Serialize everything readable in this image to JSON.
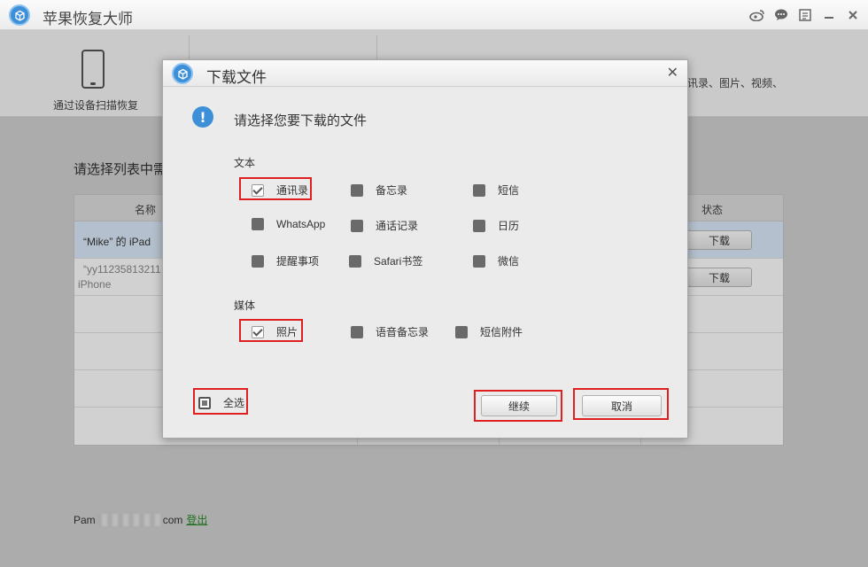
{
  "app": {
    "title": "苹果恢复大师",
    "titlebar_icons": [
      "weibo-icon",
      "chat-icon",
      "feedback-icon",
      "minimize-icon",
      "close-icon"
    ]
  },
  "toolbar": {
    "tool1_label": "通过设备扫描恢复",
    "tool_desc": "讯录、图片、视频、"
  },
  "main": {
    "heading": "请选择列表中需",
    "table": {
      "header_name": "名称",
      "header_status": "状态",
      "rows": [
        {
          "name": "“Mike” 的 iPad",
          "button": "下载",
          "selected": true
        },
        {
          "name_line1": "“yy11235813211",
          "name_line2": "iPhone",
          "button": "下载",
          "selected": false
        }
      ]
    }
  },
  "footer": {
    "account_prefix": "Pam",
    "account_suffix": "com",
    "logout": "登出"
  },
  "dialog": {
    "title": "下载文件",
    "message": "请选择您要下载的文件",
    "text_section": "文本",
    "media_section": "媒体",
    "text_options": [
      {
        "label": "通讯录",
        "checked": true
      },
      {
        "label": "备忘录",
        "checked": false
      },
      {
        "label": "短信",
        "checked": false
      },
      {
        "label": "WhatsApp",
        "checked": false
      },
      {
        "label": "通话记录",
        "checked": false
      },
      {
        "label": "日历",
        "checked": false
      },
      {
        "label": "提醒事项",
        "checked": false
      },
      {
        "label": "Safari书签",
        "checked": false
      },
      {
        "label": "微信",
        "checked": false
      }
    ],
    "media_options": [
      {
        "label": "照片",
        "checked": true
      },
      {
        "label": "语音备忘录",
        "checked": false
      },
      {
        "label": "短信附件",
        "checked": false
      }
    ],
    "select_all": "全选",
    "continue": "继续",
    "cancel": "取消",
    "highlight_color": "#e02020"
  }
}
